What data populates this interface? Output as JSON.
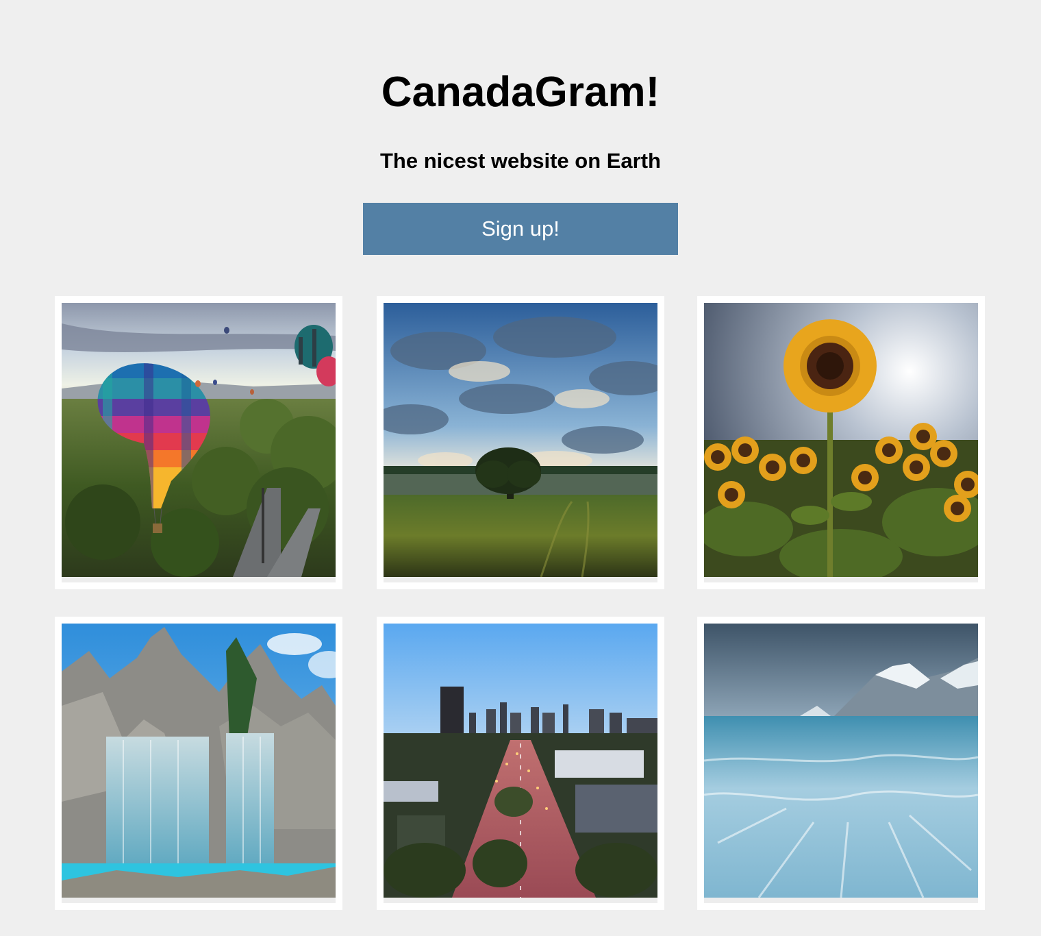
{
  "header": {
    "title": "CanadaGram!",
    "subtitle": "The nicest website on Earth",
    "signup_label": "Sign up!"
  },
  "colors": {
    "background": "#efefef",
    "button": "#5380a5",
    "card": "#ffffff"
  },
  "gallery": [
    {
      "subject": "hot-air-balloons"
    },
    {
      "subject": "lone-tree-field"
    },
    {
      "subject": "sunflowers"
    },
    {
      "subject": "waterfall-mountain"
    },
    {
      "subject": "city-street-dusk"
    },
    {
      "subject": "snowy-mountain-sea"
    }
  ]
}
